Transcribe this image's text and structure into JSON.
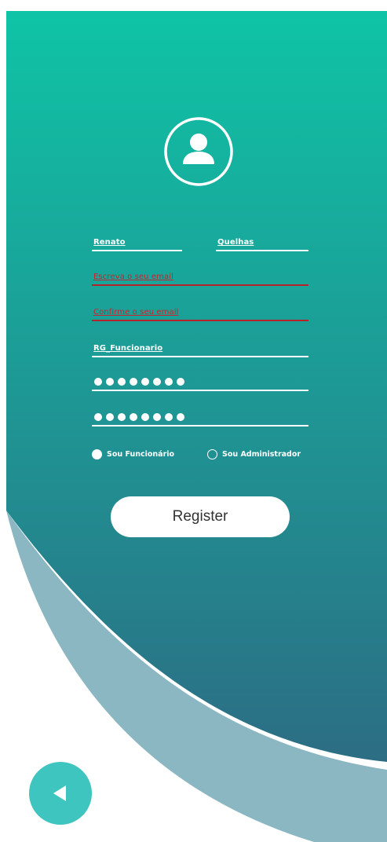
{
  "colors": {
    "gradient_top": "#0fc4a6",
    "gradient_bottom": "#2c6d84",
    "curve_band": "#8bb7c2",
    "error": "#b8232b",
    "back_button": "#3ec5c0"
  },
  "header": {
    "avatar_icon": "user-circle-icon"
  },
  "form": {
    "first_name": "Renato",
    "last_name": "Quelhas",
    "email": "Escreva o seu email",
    "confirm_email": "Confirme o seu email",
    "employee_id": "RG_Funcionario",
    "password_mask_count": 8,
    "confirm_password_mask_count": 8
  },
  "roles": {
    "option_1": "Sou Funcionário",
    "option_2": "Sou Administrador",
    "selected": "Sou Funcionário"
  },
  "actions": {
    "register_label": "Register",
    "back_icon": "triangle-left-icon"
  }
}
